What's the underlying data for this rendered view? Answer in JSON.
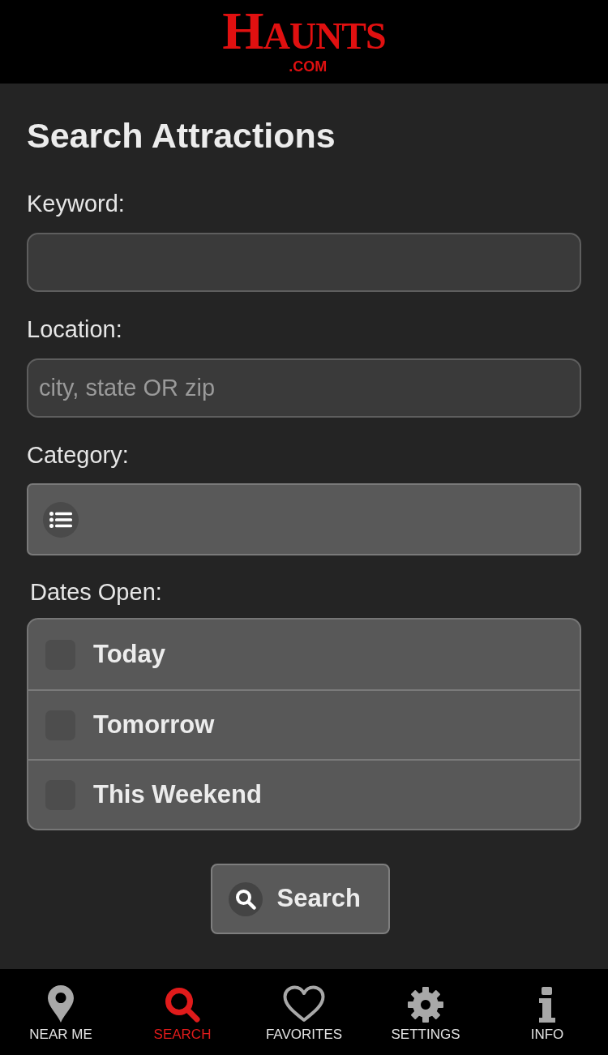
{
  "header": {
    "logo": {
      "title": "HAUNTS",
      "suffix": ".COM"
    }
  },
  "page": {
    "title": "Search Attractions"
  },
  "form": {
    "fields": [
      {
        "kind": "text",
        "label": "Keyword:"
      },
      {
        "kind": "text",
        "label": "Location:",
        "placeholder": "city, state OR zip"
      },
      {
        "kind": "select",
        "label": "Category:"
      }
    ],
    "dates": {
      "label": "Dates Open:",
      "options": [
        {
          "label": "Today",
          "checked": false
        },
        {
          "label": "Tomorrow",
          "checked": false
        },
        {
          "label": "This Weekend",
          "checked": false
        }
      ]
    },
    "submit": {
      "label": "Search"
    }
  },
  "tab_bar": [
    {
      "label": "NEAR ME",
      "selected": false
    },
    {
      "label": "SEARCH",
      "selected": true
    },
    {
      "label": "FAVORITES",
      "selected": false
    },
    {
      "label": "SETTINGS",
      "selected": false
    },
    {
      "label": "INFO",
      "selected": false
    }
  ]
}
